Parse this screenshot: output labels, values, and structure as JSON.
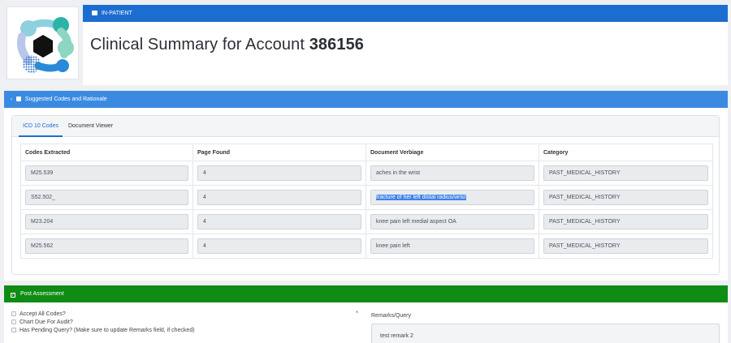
{
  "header": {
    "patient_type": "IN-PATIENT",
    "title_prefix": "Clinical Summary for Account",
    "account_number": "386156"
  },
  "suggested": {
    "section_label": "Suggested Codes and Rationale",
    "tabs": [
      {
        "label": "ICD 10 Codes",
        "active": true
      },
      {
        "label": "Document Viewer",
        "active": false
      }
    ],
    "columns": [
      "Codes Extracted",
      "Page Found",
      "Document Verbiage",
      "Category"
    ],
    "rows": [
      {
        "code": "M25.539",
        "page": "4",
        "verbiage": "aches in the wrist",
        "category": "PAST_MEDICAL_HISTORY"
      },
      {
        "code": "S52.502_",
        "page": "4",
        "verbiage": "fracture of her left distal radius/wrist",
        "category": "PAST_MEDICAL_HISTORY",
        "verbiage_selected": true
      },
      {
        "code": "M23.204",
        "page": "4",
        "verbiage": "knee pain left medial aspect OA",
        "category": "PAST_MEDICAL_HISTORY"
      },
      {
        "code": "M25.562",
        "page": "4",
        "verbiage": "knee pain left",
        "category": "PAST_MEDICAL_HISTORY"
      }
    ]
  },
  "post_assessment": {
    "section_label": "Post Assessment",
    "checkboxes": [
      {
        "label": "Accept All Codes?",
        "checked": false
      },
      {
        "label": "Chart Due For Audit?",
        "checked": false
      },
      {
        "label": "Has Pending Query? (Make sure to update Remarks field, if checked)",
        "checked": false
      }
    ],
    "required_marker": "*",
    "remarks_label": "Remarks/Query",
    "remarks_value": "test remark 2"
  },
  "colors": {
    "primary_blue": "#1c6dd0",
    "section_blue": "#3b8ae2",
    "section_green": "#0f8c14",
    "selection": "#3f82e6"
  }
}
